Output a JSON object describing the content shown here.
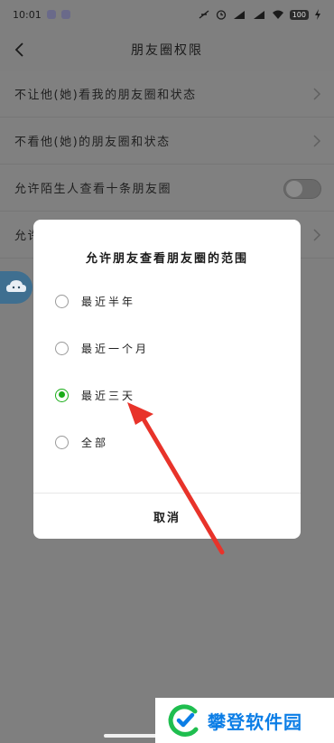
{
  "status_bar": {
    "time": "10:01",
    "battery": "100",
    "network_label": "HD"
  },
  "header": {
    "title": "朋友圈权限"
  },
  "settings": {
    "items": [
      {
        "label": "不让他(她)看我的朋友圈和状态",
        "control": "chevron"
      },
      {
        "label": "不看他(她)的朋友圈和状态",
        "control": "chevron"
      },
      {
        "label": "允许陌生人查看十条朋友圈",
        "control": "toggle",
        "toggle_on": false
      },
      {
        "label": "允许",
        "control": "chevron"
      }
    ]
  },
  "dialog": {
    "title": "允许朋友查看朋友圈的范围",
    "options": [
      {
        "label": "最近半年",
        "selected": false
      },
      {
        "label": "最近一个月",
        "selected": false
      },
      {
        "label": "最近三天",
        "selected": true
      },
      {
        "label": "全部",
        "selected": false
      }
    ],
    "cancel_label": "取消"
  },
  "watermark": {
    "text": "攀登软件园"
  },
  "colors": {
    "accent_green": "#1aad19",
    "annotation_red": "#e8332a",
    "watermark_blue": "#0c7ee6"
  }
}
